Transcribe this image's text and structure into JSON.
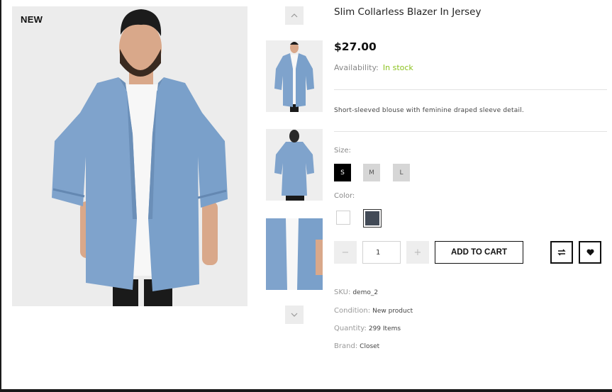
{
  "badge": "NEW",
  "product": {
    "title": "Slim Collarless Blazer In Jersey",
    "price": "$27.00",
    "availability_label": "Availability:",
    "availability_value": "In stock",
    "description": "Short-sleeved blouse with feminine draped sleeve detail."
  },
  "options": {
    "size_label": "Size:",
    "sizes": [
      "S",
      "M",
      "L"
    ],
    "selected_size": "S",
    "color_label": "Color:",
    "colors": [
      "#ffffff",
      "#424a57"
    ],
    "selected_color": "#424a57"
  },
  "cart": {
    "minus": "−",
    "quantity": "1",
    "plus": "+",
    "add_to_cart": "ADD TO CART"
  },
  "meta": {
    "sku_label": "SKU:",
    "sku_value": "demo_2",
    "condition_label": "Condition:",
    "condition_value": "New product",
    "quantity_label": "Quantity:",
    "quantity_value": "299 Items",
    "brand_label": "Brand:",
    "brand_value": "Closet"
  },
  "icons": {
    "up": "chevron-up-icon",
    "down": "chevron-down-icon",
    "compare": "compare-icon",
    "wishlist": "heart-icon"
  },
  "colors": {
    "in_stock": "#8cc21f",
    "denim": "#7fa3cc",
    "selected_size_bg": "#000000"
  }
}
